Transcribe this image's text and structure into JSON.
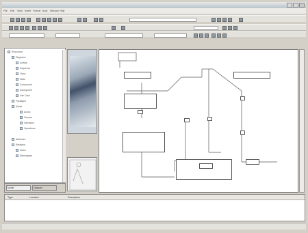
{
  "window": {
    "title": "",
    "controls": [
      "minimize-icon",
      "maximize-icon",
      "close-icon"
    ]
  },
  "menu": {
    "items": [
      "File",
      "Edit",
      "View",
      "Insert",
      "Format",
      "Tools",
      "Window",
      "Help"
    ]
  },
  "toolbar": {
    "search_value": "",
    "status_value": ""
  },
  "sidebar": {
    "items": [
      {
        "label": "Resources"
      },
      {
        "label": "Diagrams"
      },
      {
        "label": "Activity"
      },
      {
        "label": "Sequence"
      },
      {
        "label": "Class"
      },
      {
        "label": "State"
      },
      {
        "label": "Component"
      },
      {
        "label": "Deployment"
      },
      {
        "label": "Use Case"
      },
      {
        "label": "Packages"
      },
      {
        "label": "Model"
      },
      {
        "label": "Actors"
      },
      {
        "label": "Classes"
      },
      {
        "label": "Interfaces"
      },
      {
        "label": "Operations"
      },
      {
        "label": "Attributes"
      },
      {
        "label": "Relations"
      },
      {
        "label": "Notes"
      },
      {
        "label": "Stereotypes"
      }
    ],
    "tabs": [
      "Model",
      "Diagram"
    ]
  },
  "diagram": {
    "nodes": [
      {
        "label": ""
      },
      {
        "label": ""
      },
      {
        "label": ""
      },
      {
        "label": ""
      },
      {
        "label": ""
      },
      {
        "label": ""
      },
      {
        "label": ""
      }
    ]
  },
  "results": {
    "headers": [
      "Type",
      "Location",
      "Description"
    ],
    "rows": [
      {
        "type": "",
        "location": "",
        "description": ""
      },
      {
        "type": "",
        "location": "",
        "description": ""
      }
    ]
  },
  "status": {
    "left": "",
    "right": ""
  },
  "colors": {
    "frame": "#d4d0c8",
    "canvas": "#ffffff",
    "accent": "#0a246a"
  }
}
